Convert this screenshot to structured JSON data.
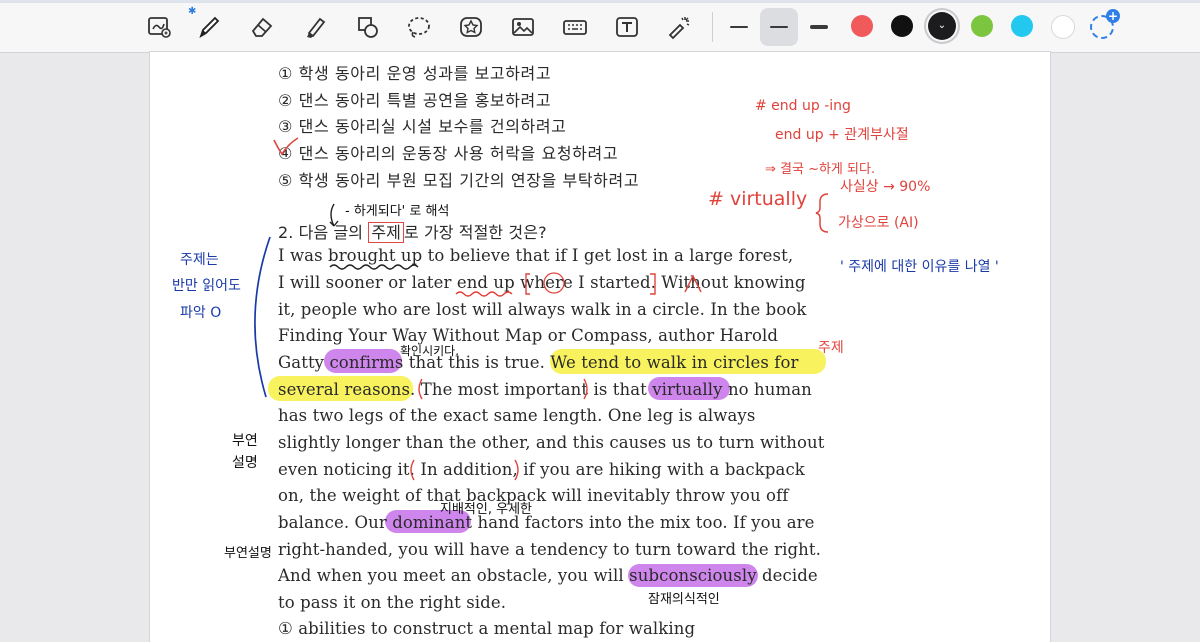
{
  "toolbar": {
    "tools": [
      {
        "name": "zoom-box-icon"
      },
      {
        "name": "pen-icon"
      },
      {
        "name": "eraser-icon"
      },
      {
        "name": "highlighter-icon"
      },
      {
        "name": "shapes-icon"
      },
      {
        "name": "lasso-icon"
      },
      {
        "name": "sticker-icon"
      },
      {
        "name": "image-icon"
      },
      {
        "name": "keyboard-icon"
      },
      {
        "name": "text-box-icon"
      },
      {
        "name": "laser-pointer-icon"
      }
    ],
    "bluetooth_mark": "✱",
    "stroke_sizes": [
      "thin",
      "medium",
      "thick"
    ],
    "selected_stroke": "medium",
    "colors": [
      "#f05a5a",
      "#111111",
      "#1c1c1e",
      "#7cc63f",
      "#22c8ee",
      "#ffffff"
    ],
    "selected_color": "#1c1c1e",
    "add_color_label": "+"
  },
  "document": {
    "choices": [
      "① 학생 동아리 운영 성과를 보고하려고",
      "② 댄스 동아리 특별 공연을 홍보하려고",
      "③ 댄스 동아리실 시설 보수를 건의하려고",
      "④ 댄스 동아리의 운동장 사용 허락을 요청하려고",
      "⑤ 학생 동아리 부원 모집 기간의 연장을 부탁하려고"
    ],
    "question": {
      "prefix": "2. 다음 글의 ",
      "boxed": "주제",
      "suffix": "로 가장 적절한 것은?"
    },
    "passage": [
      "I was brought up to believe that if I get lost in a large forest,",
      "I will sooner or later end up where I started. Without knowing",
      "it, people who are lost will always walk in a circle. In the book",
      "Finding Your Way Without Map or Compass, author Harold",
      "Gatty confirms that this is true. We tend to walk in circles for",
      "several reasons. The most important is that virtually no human",
      "has two legs of the exact same length. One leg is always",
      "slightly longer than the other, and this causes us to turn without",
      "even noticing it. In addition, if you are hiking with a backpack",
      "on, the weight of that backpack will inevitably throw you off",
      "balance. Our dominant hand factors into the mix too. If you are",
      "right-handed, you will have a tendency to turn toward the right.",
      "And when you meet an obstacle, you will subconsciously decide",
      "to pass it on the right side."
    ],
    "answer_partial": "① abilities to construct a mental map for walking"
  },
  "annotations": {
    "red": [
      "# end up -ing",
      "end up + 관계부사절",
      "⇒ 결국 ~하게 되다.",
      "# virtually",
      "사실상 → 90%",
      "가상으로 (AI)",
      "주제",
      "∨"
    ],
    "blue": [
      "주제는",
      "반만 읽어도",
      "파악 O",
      "' 주제에 대한 이유를 나열 '"
    ],
    "black": [
      "- 하게되다' 로 해석",
      "확인시키다.",
      "부연",
      "설명",
      "지배적인, 우세한",
      "부연설명",
      "잠재의식적인"
    ]
  }
}
